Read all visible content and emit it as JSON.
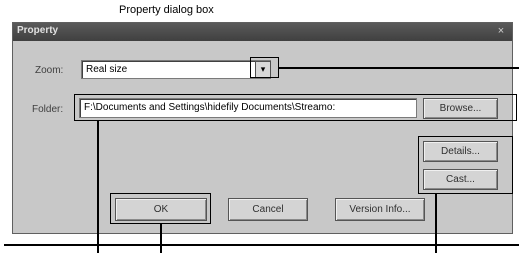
{
  "caption": "Property dialog box",
  "dialog": {
    "title": "Property",
    "close_glyph": "×",
    "zoom_label": "Zoom:",
    "zoom_value": "Real size",
    "zoom_arrow": "▾",
    "folder_label": "Folder:",
    "folder_value": "F:\\Documents and Settings\\hidefily Documents\\Streamo:",
    "buttons": {
      "browse": "Browse...",
      "details": "Details...",
      "cast": "Cast...",
      "ok": "OK",
      "cancel": "Cancel",
      "version": "Version Info..."
    }
  },
  "colors": {
    "dialog_bg": "#c8c8c8",
    "titlebar": "#404040",
    "callout": "#000000"
  },
  "icons": [
    "close-icon",
    "chevron-down-icon"
  ]
}
